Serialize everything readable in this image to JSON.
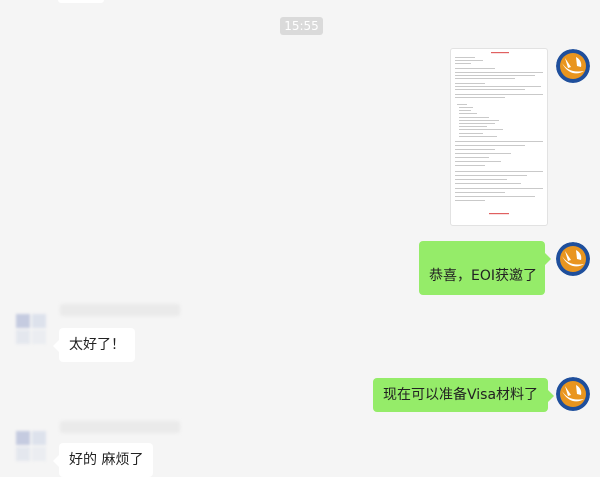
{
  "chat": {
    "timestamp": "15:55",
    "messages": [
      {
        "sender": "me",
        "type": "file",
        "icon": "document-preview"
      },
      {
        "sender": "me",
        "type": "text",
        "text": "恭喜，EOI获邀了"
      },
      {
        "sender": "contact",
        "type": "text",
        "text": "太好了！"
      },
      {
        "sender": "me",
        "type": "text",
        "text": "现在可以准备Visa材料了"
      },
      {
        "sender": "contact",
        "type": "text",
        "text": "好的 麻烦了"
      }
    ]
  },
  "colors": {
    "background": "#f5f5f5",
    "sent_bubble": "#95ec69",
    "received_bubble": "#ffffff",
    "timestamp_bg": "#dadada"
  }
}
